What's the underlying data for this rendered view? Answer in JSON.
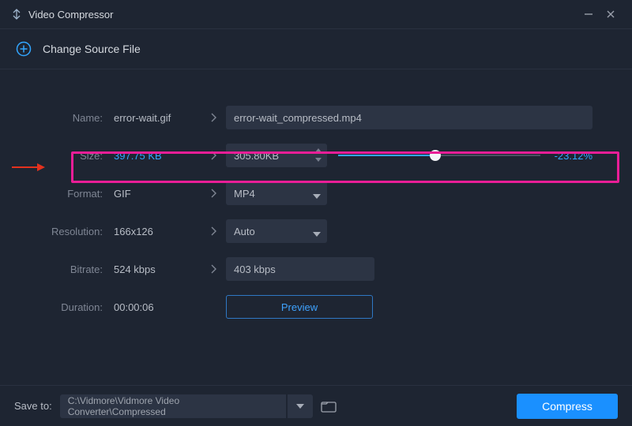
{
  "app": {
    "title": "Video Compressor"
  },
  "source": {
    "change_label": "Change Source File"
  },
  "labels": {
    "name": "Name:",
    "size": "Size:",
    "format": "Format:",
    "resolution": "Resolution:",
    "bitrate": "Bitrate:",
    "duration": "Duration:"
  },
  "values": {
    "name_source": "error-wait.gif",
    "name_output": "error-wait_compressed.mp4",
    "size_source": "397.75 KB",
    "size_output": "305.80KB",
    "size_pct": "-23.12%",
    "size_slider_fill_pct": 48,
    "format_source": "GIF",
    "format_output": "MP4",
    "resolution_source": "166x126",
    "resolution_output": "Auto",
    "bitrate_source": "524 kbps",
    "bitrate_output": "403 kbps",
    "duration": "00:00:06"
  },
  "buttons": {
    "preview": "Preview",
    "compress": "Compress"
  },
  "footer": {
    "save_label": "Save to:",
    "path": "C:\\Vidmore\\Vidmore Video Converter\\Compressed"
  }
}
